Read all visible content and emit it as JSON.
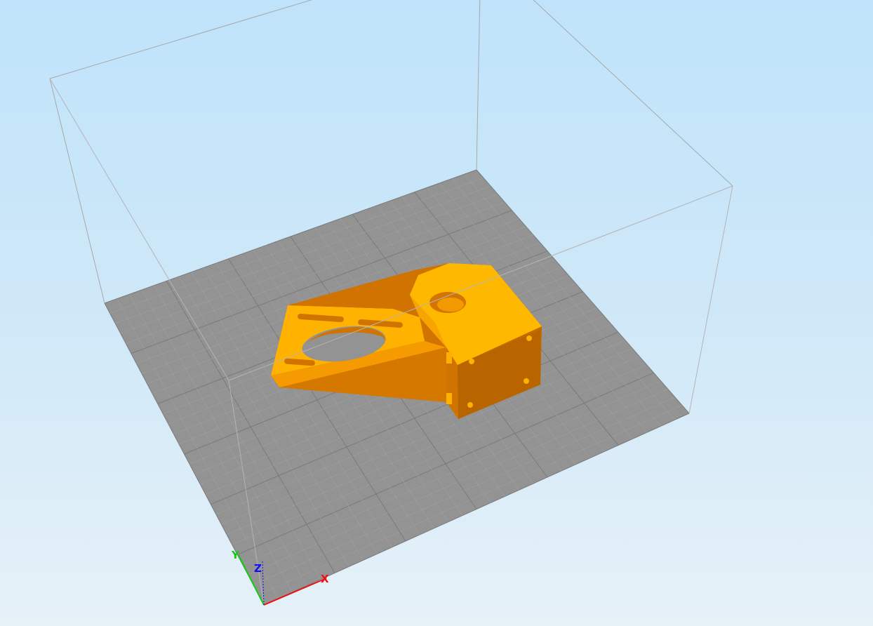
{
  "viewport": {
    "background_top": "#bfe3fa",
    "background_bottom": "#e6f1f8"
  },
  "build_plate": {
    "color": "#939393",
    "grid_minor_color": "#a0a0a0",
    "grid_major_color": "#7a7a7a",
    "minor_divisions": 30,
    "major_every": 5
  },
  "build_volume": {
    "edge_color": "#a8a8a8"
  },
  "model": {
    "color_light": "#ffb800",
    "color_mid": "#f79d00",
    "color_dark": "#d07300"
  },
  "axes": {
    "x_label": "X",
    "y_label": "Y",
    "z_label": "Z",
    "x_color": "#ee1111",
    "y_color": "#11cc11",
    "z_color": "#1111ee"
  }
}
